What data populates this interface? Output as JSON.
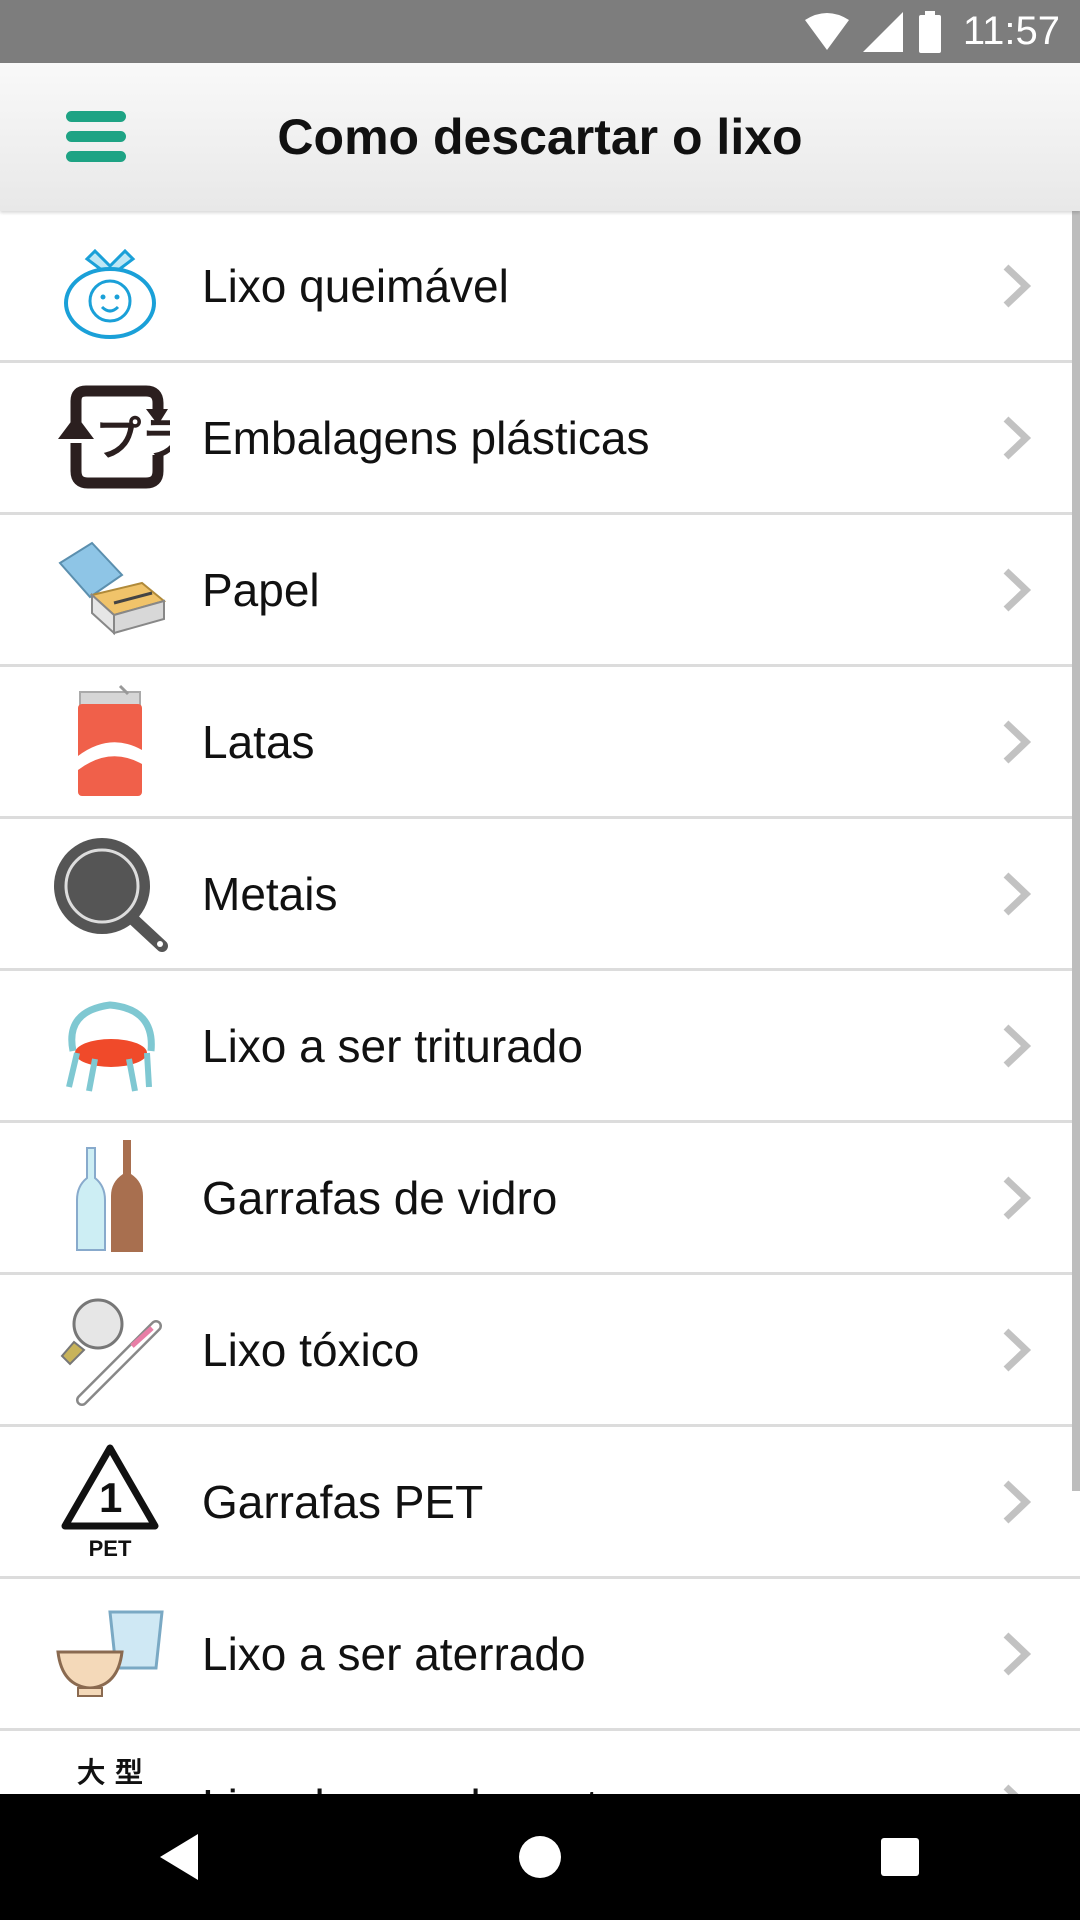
{
  "status": {
    "time": "11:57"
  },
  "header": {
    "title": "Como descartar o lixo"
  },
  "colors": {
    "accent": "#1ea384",
    "chevron": "#c2c2c2"
  },
  "list": {
    "items": [
      {
        "label": "Lixo queimável",
        "icon": "burnable-bag-icon"
      },
      {
        "label": "Embalagens plásticas",
        "icon": "plastic-recycle-icon"
      },
      {
        "label": "Papel",
        "icon": "paper-stack-icon"
      },
      {
        "label": "Latas",
        "icon": "can-icon"
      },
      {
        "label": "Metais",
        "icon": "frying-pan-icon"
      },
      {
        "label": "Lixo a ser triturado",
        "icon": "chair-icon"
      },
      {
        "label": "Garrafas de vidro",
        "icon": "glass-bottles-icon"
      },
      {
        "label": "Lixo tóxico",
        "icon": "bulb-thermometer-icon"
      },
      {
        "label": "Garrafas PET",
        "icon": "pet-recycle-icon",
        "icon_text": "PET"
      },
      {
        "label": "Lixo a ser aterrado",
        "icon": "ceramic-glass-icon"
      },
      {
        "label": "Lixo de grande porte",
        "icon": "large-furniture-icon",
        "icon_text": "大 型"
      }
    ]
  }
}
